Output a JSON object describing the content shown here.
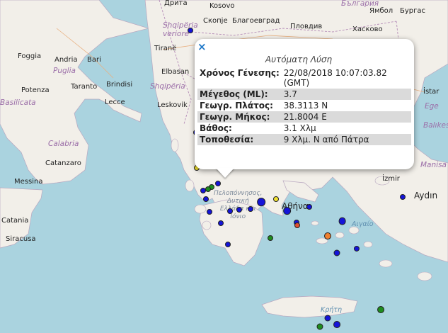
{
  "popup": {
    "close": "×",
    "title": "Αυτόματη Λύση",
    "rows": [
      {
        "key": "Χρόνος Γένεσης:",
        "value": "22/08/2018 10:07:03.82 (GMT)"
      },
      {
        "key": "Μέγεθος (ML):",
        "value": "3.7"
      },
      {
        "key": "Γεωγρ. Πλάτος:",
        "value": "38.3113 N"
      },
      {
        "key": "Γεωγρ. Μήκος:",
        "value": "21.8004 E"
      },
      {
        "key": "Βάθος:",
        "value": "3.1 Χλμ"
      },
      {
        "key": "Τοποθεσία:",
        "value": "9 Χλμ. Ν από Πάτρα"
      }
    ]
  },
  "labels": {
    "albania": "Shqipëria",
    "albania_ve": "Shqipëria\nveriore",
    "kosovo": "Kosovo",
    "bulgaria": "България",
    "skopje": "Скопје",
    "blagoevgrad": "Благоевград",
    "plovdiv": "Пловдив",
    "haskovo": "Хасково",
    "yambol": "Ямбол",
    "burgas": "Бургас",
    "tirane": "Tiranë",
    "elbasan": "Elbasan",
    "leskovik": "Leskovik",
    "foggia": "Foggia",
    "andria": "Andria",
    "bari": "Bari",
    "puglia": "Puglia",
    "potenza": "Potenza",
    "taranto": "Taranto",
    "brindisi": "Brindisi",
    "lecce": "Lecce",
    "basilicata": "Basilicata",
    "calabria": "Calabria",
    "catanzaro": "Catanzaro",
    "messina": "Messina",
    "catania": "Catania",
    "siracusa": "Siracusa",
    "peloponnisos": "Πελοπόννησος,\nΔυτική\nΕλλάδα και\nΙόνιο",
    "athina": "Αθήνα",
    "aigaio": "Αιγαίο",
    "kriti": "Κρήτη",
    "izmir": "İzmir",
    "aydin": "Aydın",
    "manisa": "Manisa",
    "balikesir": "Balıkesir",
    "ist": "İstar",
    "ege": "Ege",
    "drita": "Дрита"
  },
  "quakes": [
    {
      "lon": 19.88,
      "lat": 42.37,
      "mag": 3.2,
      "color": "#1414d8"
    },
    {
      "lon": 20.56,
      "lat": 40.43,
      "mag": 3.4,
      "color": "#1414d8"
    },
    {
      "lon": 20.02,
      "lat": 39.96,
      "mag": 3.1,
      "color": "#1414d8"
    },
    {
      "lon": 20.35,
      "lat": 39.9,
      "mag": 3.0,
      "color": "#1414d8"
    },
    {
      "lon": 20.28,
      "lat": 39.7,
      "mag": 3.0,
      "color": "#1414d8"
    },
    {
      "lon": 20.5,
      "lat": 39.45,
      "mag": 3.0,
      "color": "#1414d8"
    },
    {
      "lon": 20.05,
      "lat": 39.12,
      "mag": 3.0,
      "color": "#f0e030"
    },
    {
      "lon": 20.62,
      "lat": 38.75,
      "mag": 3.2,
      "color": "#1414d8"
    },
    {
      "lon": 20.45,
      "lat": 38.66,
      "mag": 3.0,
      "color": "#1e8c1e"
    },
    {
      "lon": 20.35,
      "lat": 38.62,
      "mag": 3.0,
      "color": "#1e8c1e"
    },
    {
      "lon": 20.22,
      "lat": 38.58,
      "mag": 3.0,
      "color": "#1414d8"
    },
    {
      "lon": 20.3,
      "lat": 38.38,
      "mag": 3.0,
      "color": "#1414d8"
    },
    {
      "lon": 20.4,
      "lat": 38.07,
      "mag": 3.0,
      "color": "#1414d8"
    },
    {
      "lon": 20.95,
      "lat": 38.1,
      "mag": 3.0,
      "color": "#1414d8"
    },
    {
      "lon": 21.2,
      "lat": 38.12,
      "mag": 3.1,
      "color": "#1414d8"
    },
    {
      "lon": 21.5,
      "lat": 38.15,
      "mag": 3.2,
      "color": "#1414d8"
    },
    {
      "lon": 21.8,
      "lat": 38.31,
      "mag": 3.7,
      "color": "#1414d8"
    },
    {
      "lon": 22.2,
      "lat": 38.38,
      "mag": 3.0,
      "color": "#f0e030"
    },
    {
      "lon": 22.5,
      "lat": 38.1,
      "mag": 3.7,
      "color": "#1414d8"
    },
    {
      "lon": 22.75,
      "lat": 37.82,
      "mag": 3.0,
      "color": "#1414d8"
    },
    {
      "lon": 22.78,
      "lat": 37.75,
      "mag": 3.0,
      "color": "#e05030"
    },
    {
      "lon": 22.05,
      "lat": 37.45,
      "mag": 3.0,
      "color": "#1e8c1e"
    },
    {
      "lon": 20.7,
      "lat": 37.8,
      "mag": 3.0,
      "color": "#1414d8"
    },
    {
      "lon": 20.9,
      "lat": 37.3,
      "mag": 3.0,
      "color": "#1414d8"
    },
    {
      "lon": 23.1,
      "lat": 38.2,
      "mag": 3.0,
      "color": "#1414d8"
    },
    {
      "lon": 24.0,
      "lat": 37.86,
      "mag": 3.6,
      "color": "#1414d8"
    },
    {
      "lon": 23.6,
      "lat": 37.5,
      "mag": 3.5,
      "color": "#f08030"
    },
    {
      "lon": 23.85,
      "lat": 37.1,
      "mag": 3.4,
      "color": "#1414d8"
    },
    {
      "lon": 24.4,
      "lat": 37.2,
      "mag": 3.3,
      "color": "#1414d8"
    },
    {
      "lon": 25.65,
      "lat": 38.42,
      "mag": 3.0,
      "color": "#1414d8"
    },
    {
      "lon": 25.05,
      "lat": 35.75,
      "mag": 3.5,
      "color": "#1e8c1e"
    },
    {
      "lon": 23.6,
      "lat": 35.55,
      "mag": 3.4,
      "color": "#1414d8"
    },
    {
      "lon": 23.85,
      "lat": 35.4,
      "mag": 3.5,
      "color": "#1414d8"
    },
    {
      "lon": 23.4,
      "lat": 35.35,
      "mag": 3.4,
      "color": "#1e8c1e"
    }
  ]
}
